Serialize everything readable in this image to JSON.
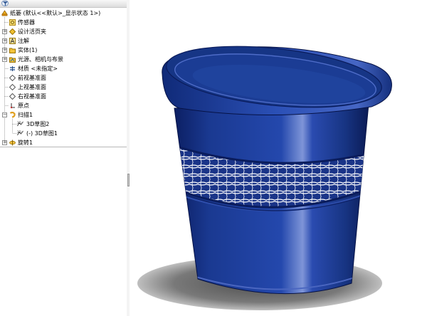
{
  "tree": {
    "root_label": "纸篓 (默认<<默认>_显示状态 1>)",
    "items": [
      {
        "label": "传感器",
        "icon": "sensor-icon"
      },
      {
        "label": "设计活页夹",
        "icon": "design-binder-icon"
      },
      {
        "label": "注解",
        "icon": "annotations-icon"
      },
      {
        "label": "实体(1)",
        "icon": "solid-bodies-icon"
      },
      {
        "label": "光源、相机与布景",
        "icon": "lights-cameras-scenery-icon"
      },
      {
        "label": "材质 <未指定>",
        "icon": "material-icon"
      },
      {
        "label": "前视基准面",
        "icon": "plane-icon"
      },
      {
        "label": "上视基准面",
        "icon": "plane-icon"
      },
      {
        "label": "右视基准面",
        "icon": "plane-icon"
      },
      {
        "label": "原点",
        "icon": "origin-icon"
      },
      {
        "label": "扫描1",
        "icon": "sweep-feature-icon"
      },
      {
        "label": "3D草图2",
        "icon": "3d-sketch-icon"
      },
      {
        "label": "(-) 3D草图1",
        "icon": "3d-sketch-icon"
      },
      {
        "label": "旋转1",
        "icon": "revolve-feature-icon"
      }
    ]
  },
  "colors": {
    "basket_blue": "#1c3d94",
    "basket_dark": "#0b1d5a",
    "shadow": "#5a5a5a",
    "folder_yellow": "#f3c33a"
  }
}
